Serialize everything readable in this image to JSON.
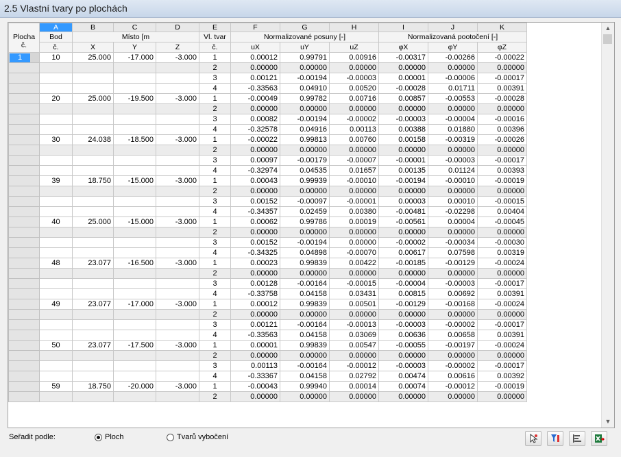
{
  "window": {
    "title": "2.5 Vlastní tvary po plochách"
  },
  "columns": {
    "letters": [
      "A",
      "B",
      "C",
      "D",
      "E",
      "F",
      "G",
      "H",
      "I",
      "J",
      "K"
    ],
    "header1": {
      "plocha": "Plocha",
      "bod": "Bod",
      "misto": "Místo [m",
      "vl_tvar": "Vl. tvar",
      "posuny": "Normalizované posuny [-]",
      "pootoceni": "Normalizovaná pootočení [-]"
    },
    "header2": {
      "plocha": "č.",
      "bod": "č.",
      "x": "X",
      "y": "Y",
      "z": "Z",
      "tvar": "č.",
      "ux": "uX",
      "uy": "uY",
      "uz": "uZ",
      "px": "φX",
      "py": "φY",
      "pz": "φZ"
    }
  },
  "rows": [
    [
      "1",
      "10",
      "25.000",
      "-17.000",
      "-3.000",
      "1",
      "0.00012",
      "0.99791",
      "0.00916",
      "-0.00317",
      "-0.00266",
      "-0.00022"
    ],
    [
      "",
      "",
      "",
      "",
      "",
      "2",
      "0.00000",
      "0.00000",
      "0.00000",
      "0.00000",
      "0.00000",
      "0.00000"
    ],
    [
      "",
      "",
      "",
      "",
      "",
      "3",
      "0.00121",
      "-0.00194",
      "-0.00003",
      "0.00001",
      "-0.00006",
      "-0.00017"
    ],
    [
      "",
      "",
      "",
      "",
      "",
      "4",
      "-0.33563",
      "0.04910",
      "0.00520",
      "-0.00028",
      "0.01711",
      "0.00391"
    ],
    [
      "",
      "20",
      "25.000",
      "-19.500",
      "-3.000",
      "1",
      "-0.00049",
      "0.99782",
      "0.00716",
      "0.00857",
      "-0.00553",
      "-0.00028"
    ],
    [
      "",
      "",
      "",
      "",
      "",
      "2",
      "0.00000",
      "0.00000",
      "0.00000",
      "0.00000",
      "0.00000",
      "0.00000"
    ],
    [
      "",
      "",
      "",
      "",
      "",
      "3",
      "0.00082",
      "-0.00194",
      "-0.00002",
      "-0.00003",
      "-0.00004",
      "-0.00016"
    ],
    [
      "",
      "",
      "",
      "",
      "",
      "4",
      "-0.32578",
      "0.04916",
      "0.00113",
      "0.00388",
      "0.01880",
      "0.00396"
    ],
    [
      "",
      "30",
      "24.038",
      "-18.500",
      "-3.000",
      "1",
      "-0.00022",
      "0.99813",
      "0.00760",
      "0.00158",
      "-0.00319",
      "-0.00026"
    ],
    [
      "",
      "",
      "",
      "",
      "",
      "2",
      "0.00000",
      "0.00000",
      "0.00000",
      "0.00000",
      "0.00000",
      "0.00000"
    ],
    [
      "",
      "",
      "",
      "",
      "",
      "3",
      "0.00097",
      "-0.00179",
      "-0.00007",
      "-0.00001",
      "-0.00003",
      "-0.00017"
    ],
    [
      "",
      "",
      "",
      "",
      "",
      "4",
      "-0.32974",
      "0.04535",
      "0.01657",
      "0.00135",
      "0.01124",
      "0.00393"
    ],
    [
      "",
      "39",
      "18.750",
      "-15.000",
      "-3.000",
      "1",
      "0.00043",
      "0.99939",
      "-0.00010",
      "-0.00194",
      "-0.00010",
      "-0.00019"
    ],
    [
      "",
      "",
      "",
      "",
      "",
      "2",
      "0.00000",
      "0.00000",
      "0.00000",
      "0.00000",
      "0.00000",
      "0.00000"
    ],
    [
      "",
      "",
      "",
      "",
      "",
      "3",
      "0.00152",
      "-0.00097",
      "-0.00001",
      "0.00003",
      "0.00010",
      "-0.00015"
    ],
    [
      "",
      "",
      "",
      "",
      "",
      "4",
      "-0.34357",
      "0.02459",
      "0.00380",
      "-0.00481",
      "-0.02298",
      "0.00404"
    ],
    [
      "",
      "40",
      "25.000",
      "-15.000",
      "-3.000",
      "1",
      "0.00062",
      "0.99786",
      "0.00019",
      "-0.00561",
      "0.00004",
      "-0.00045"
    ],
    [
      "",
      "",
      "",
      "",
      "",
      "2",
      "0.00000",
      "0.00000",
      "0.00000",
      "0.00000",
      "0.00000",
      "0.00000"
    ],
    [
      "",
      "",
      "",
      "",
      "",
      "3",
      "0.00152",
      "-0.00194",
      "0.00000",
      "-0.00002",
      "-0.00034",
      "-0.00030"
    ],
    [
      "",
      "",
      "",
      "",
      "",
      "4",
      "-0.34325",
      "0.04898",
      "-0.00070",
      "0.00617",
      "0.07598",
      "0.00319"
    ],
    [
      "",
      "48",
      "23.077",
      "-16.500",
      "-3.000",
      "1",
      "0.00023",
      "0.99839",
      "0.00422",
      "-0.00185",
      "-0.00129",
      "-0.00024"
    ],
    [
      "",
      "",
      "",
      "",
      "",
      "2",
      "0.00000",
      "0.00000",
      "0.00000",
      "0.00000",
      "0.00000",
      "0.00000"
    ],
    [
      "",
      "",
      "",
      "",
      "",
      "3",
      "0.00128",
      "-0.00164",
      "-0.00015",
      "-0.00004",
      "-0.00003",
      "-0.00017"
    ],
    [
      "",
      "",
      "",
      "",
      "",
      "4",
      "-0.33758",
      "0.04158",
      "0.03431",
      "0.00815",
      "0.00692",
      "0.00391"
    ],
    [
      "",
      "49",
      "23.077",
      "-17.000",
      "-3.000",
      "1",
      "0.00012",
      "0.99839",
      "0.00501",
      "-0.00129",
      "-0.00168",
      "-0.00024"
    ],
    [
      "",
      "",
      "",
      "",
      "",
      "2",
      "0.00000",
      "0.00000",
      "0.00000",
      "0.00000",
      "0.00000",
      "0.00000"
    ],
    [
      "",
      "",
      "",
      "",
      "",
      "3",
      "0.00121",
      "-0.00164",
      "-0.00013",
      "-0.00003",
      "-0.00002",
      "-0.00017"
    ],
    [
      "",
      "",
      "",
      "",
      "",
      "4",
      "-0.33563",
      "0.04158",
      "0.03069",
      "0.00636",
      "0.00658",
      "0.00391"
    ],
    [
      "",
      "50",
      "23.077",
      "-17.500",
      "-3.000",
      "1",
      "0.00001",
      "0.99839",
      "0.00547",
      "-0.00055",
      "-0.00197",
      "-0.00024"
    ],
    [
      "",
      "",
      "",
      "",
      "",
      "2",
      "0.00000",
      "0.00000",
      "0.00000",
      "0.00000",
      "0.00000",
      "0.00000"
    ],
    [
      "",
      "",
      "",
      "",
      "",
      "3",
      "0.00113",
      "-0.00164",
      "-0.00012",
      "-0.00003",
      "-0.00002",
      "-0.00017"
    ],
    [
      "",
      "",
      "",
      "",
      "",
      "4",
      "-0.33367",
      "0.04158",
      "0.02792",
      "0.00474",
      "0.00616",
      "0.00392"
    ],
    [
      "",
      "59",
      "18.750",
      "-20.000",
      "-3.000",
      "1",
      "-0.00043",
      "0.99940",
      "0.00014",
      "0.00074",
      "-0.00012",
      "-0.00019"
    ],
    [
      "",
      "",
      "",
      "",
      "",
      "2",
      "0.00000",
      "0.00000",
      "0.00000",
      "0.00000",
      "0.00000",
      "0.00000"
    ]
  ],
  "footer": {
    "sort_label": "Seřadit podle:",
    "options": [
      "Ploch",
      "Tvarů vybočení"
    ],
    "selected": "Ploch"
  },
  "toolbar": [
    "pick-icon",
    "filter-icon",
    "sort-icon",
    "export-excel-icon"
  ],
  "colors": {
    "selection": "#3399ff",
    "title_bar": "#d0dcec",
    "grid_border": "#c8c8c8",
    "shaded_row": "#ececec"
  }
}
